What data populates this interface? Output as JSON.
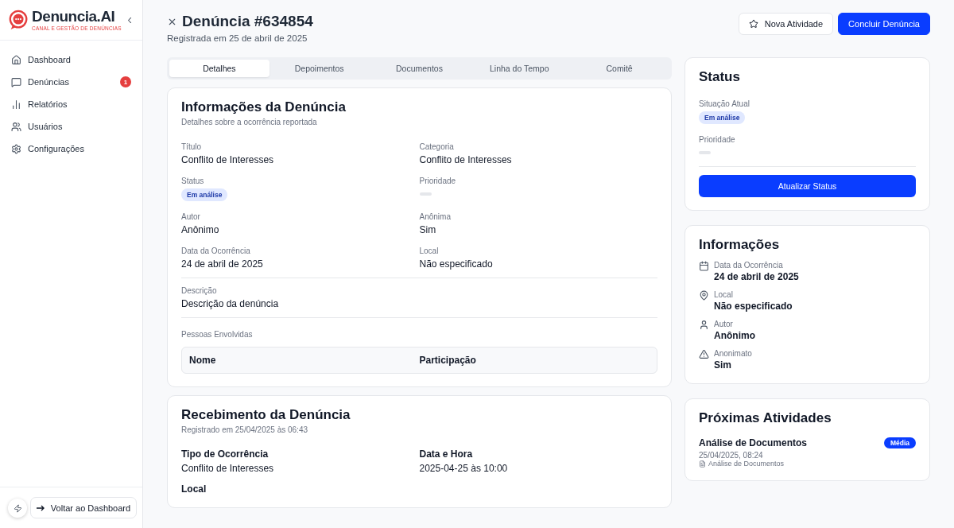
{
  "logo": {
    "name": "Denuncia.AI",
    "tagline": "CANAL E GESTÃO DE DENÚNCIAS"
  },
  "nav": [
    {
      "label": "Dashboard"
    },
    {
      "label": "Denúncias",
      "badge": "1"
    },
    {
      "label": "Relatórios"
    },
    {
      "label": "Usuários"
    },
    {
      "label": "Configurações"
    }
  ],
  "back_button": "Voltar ao Dashboard",
  "header": {
    "title": "Denúncia #634854",
    "subtitle": "Registrada em 25 de abril de 2025"
  },
  "actions": [
    {
      "label": "Nova Atividade",
      "kind": "outline"
    },
    {
      "label": "Concluir Denúncia",
      "kind": "primary"
    }
  ],
  "tabs": [
    {
      "label": "Detalhes",
      "selected": true
    },
    {
      "label": "Depoimentos",
      "selected": false
    },
    {
      "label": "Documentos",
      "selected": false
    },
    {
      "label": "Linha do Tempo",
      "selected": false
    },
    {
      "label": "Comitê",
      "selected": false
    }
  ],
  "details": {
    "title": "Informações da Denúncia",
    "subtitle": "Detalhes sobre a ocorrência reportada",
    "fields": [
      {
        "label": "Título",
        "value": "Conflito de Interesses",
        "kind": "text"
      },
      {
        "label": "Categoria",
        "value": "Conflito de Interesses",
        "kind": "text"
      },
      {
        "label": "Status",
        "value": "Em análise",
        "kind": "badge"
      },
      {
        "label": "Prioridade",
        "kind": "empty"
      },
      {
        "label": "Autor",
        "value": "Anônimo",
        "kind": "text"
      },
      {
        "label": "Anônima",
        "value": "Sim",
        "kind": "text"
      },
      {
        "label": "Data da Ocorrência",
        "value": "24 de abril de 2025",
        "kind": "text"
      },
      {
        "label": "Local",
        "value": "Não especificado",
        "kind": "text"
      }
    ],
    "description": {
      "label": "Descrição",
      "value": "Descrição da denúncia"
    },
    "people": {
      "label": "Pessoas Envolvidas",
      "columns": [
        "Nome",
        "Participação"
      ]
    }
  },
  "receipt": {
    "title": "Recebimento da Denúncia",
    "subtitle": "Registrado em 25/04/2025 às 06:43",
    "fields": [
      {
        "label": "Tipo de Ocorrência",
        "value": "Conflito de Interesses"
      },
      {
        "label": "Data e Hora",
        "value": "2025-04-25 às 10:00"
      },
      {
        "label": "Local"
      }
    ]
  },
  "status_card": {
    "title": "Status",
    "fields": [
      {
        "label": "Situação Atual",
        "value": "Em análise",
        "kind": "badge"
      },
      {
        "label": "Prioridade",
        "kind": "empty"
      }
    ],
    "button": "Atualizar Status"
  },
  "info_card": {
    "title": "Informações",
    "items": [
      {
        "label": "Data da Ocorrência",
        "value": "24 de abril de 2025"
      },
      {
        "label": "Local",
        "value": "Não especificado"
      },
      {
        "label": "Autor",
        "value": "Anônimo"
      },
      {
        "label": "Anonimato",
        "value": "Sim"
      }
    ]
  },
  "activities": {
    "title": "Próximas Atividades",
    "items": [
      {
        "title": "Análise de Documentos",
        "priority": "Média",
        "date": "25/04/2025, 08:24",
        "document": "Análise de Documentos"
      }
    ]
  }
}
